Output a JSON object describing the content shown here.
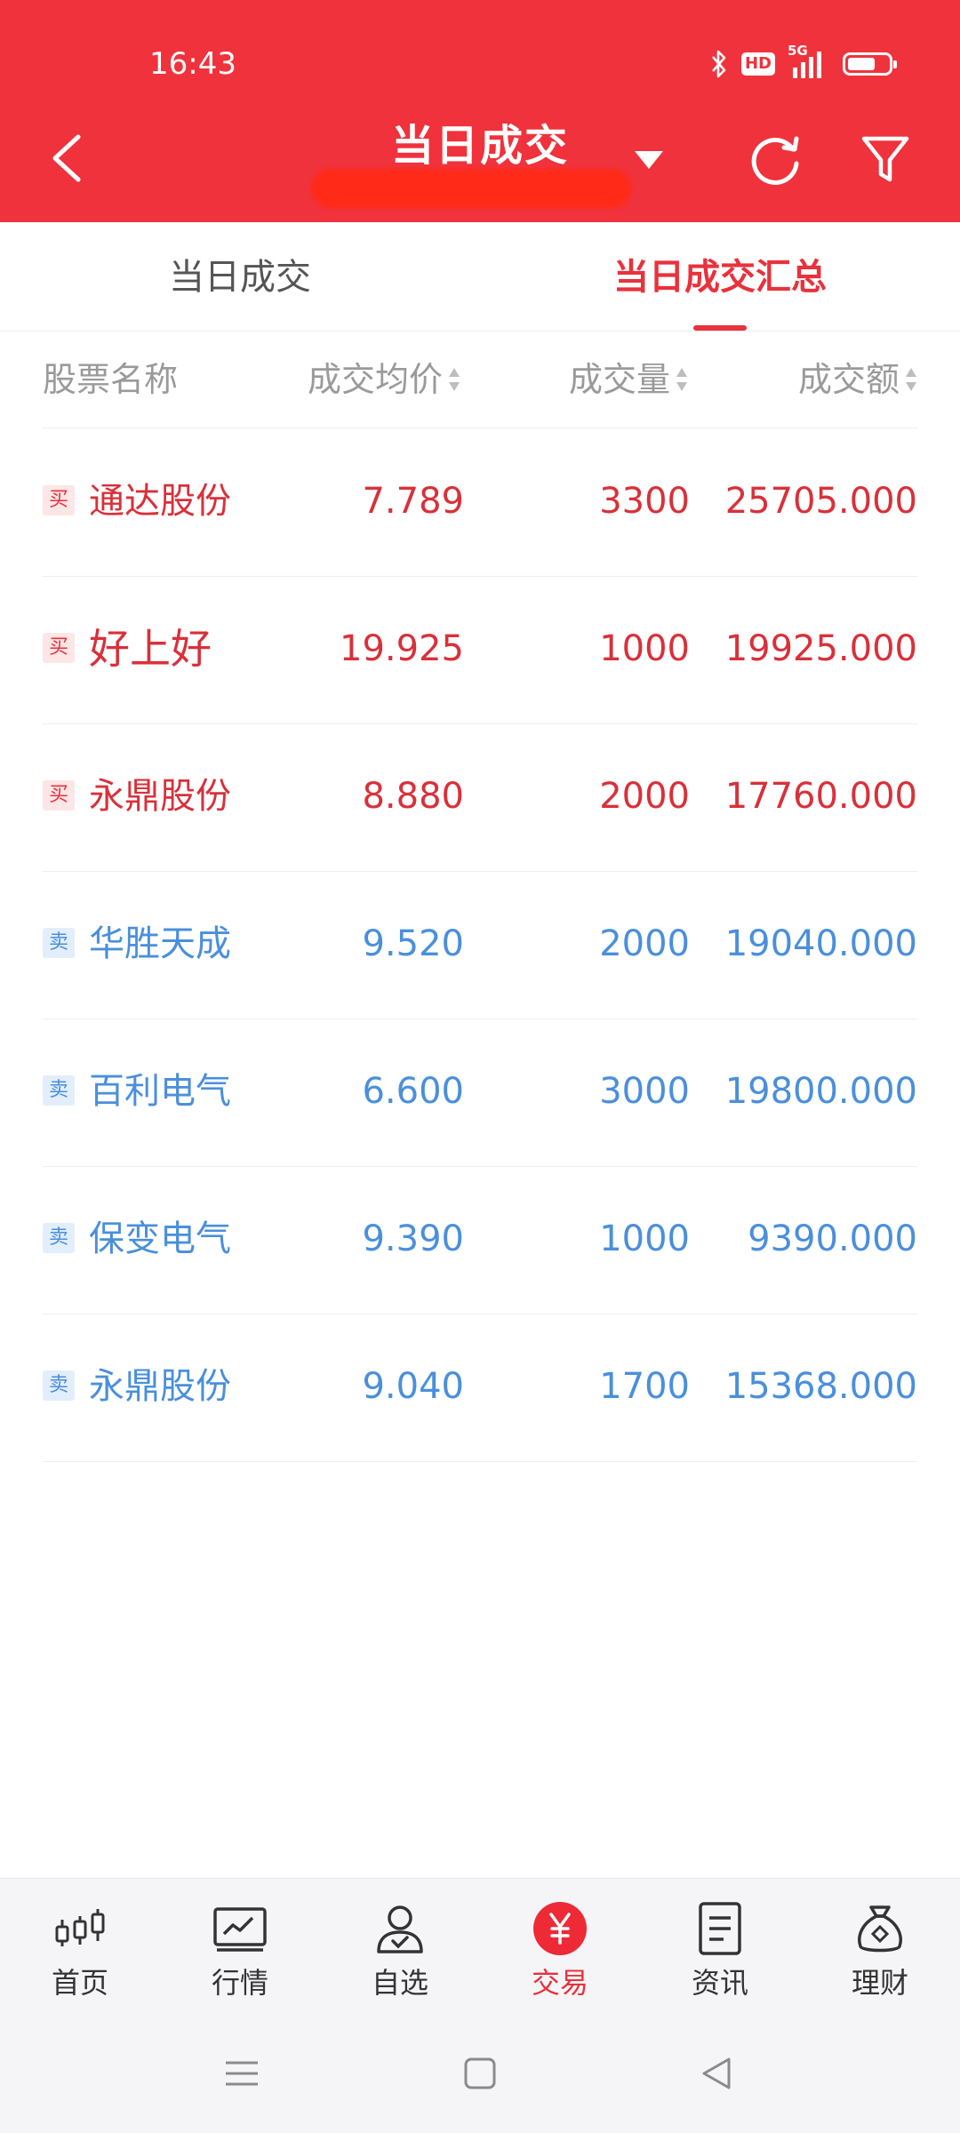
{
  "status_bar": {
    "time": "16:43",
    "hd": "HD",
    "network": "5G",
    "icons": [
      "bluetooth-icon",
      "hd-icon",
      "signal-icon",
      "battery-icon"
    ]
  },
  "header": {
    "title": "当日成交",
    "buttons": [
      "back-icon",
      "dropdown-icon",
      "refresh-icon",
      "filter-icon"
    ],
    "background_color": "#f0323c"
  },
  "tabs": [
    {
      "label": "当日成交",
      "active": false
    },
    {
      "label": "当日成交汇总",
      "active": true
    }
  ],
  "table": {
    "headers": [
      "股票名称",
      "成交均价",
      "成交量",
      "成交额"
    ],
    "rows": [
      {
        "side": "买",
        "name": "通达股份",
        "price": "7.789",
        "volume": "3300",
        "amount": "25705.000"
      },
      {
        "side": "买",
        "name": "好上好",
        "price": "19.925",
        "volume": "1000",
        "amount": "19925.000"
      },
      {
        "side": "买",
        "name": "永鼎股份",
        "price": "8.880",
        "volume": "2000",
        "amount": "17760.000"
      },
      {
        "side": "卖",
        "name": "华胜天成",
        "price": "9.520",
        "volume": "2000",
        "amount": "19040.000"
      },
      {
        "side": "卖",
        "name": "百利电气",
        "price": "6.600",
        "volume": "3000",
        "amount": "19800.000"
      },
      {
        "side": "卖",
        "name": "保变电气",
        "price": "9.390",
        "volume": "1000",
        "amount": "9390.000"
      },
      {
        "side": "卖",
        "name": "永鼎股份",
        "price": "9.040",
        "volume": "1700",
        "amount": "15368.000"
      }
    ],
    "buy_color": "#d9303a",
    "sell_color": "#4a8fdc"
  },
  "bottom_nav": [
    {
      "label": "首页",
      "icon": "candlestick-icon"
    },
    {
      "label": "行情",
      "icon": "chart-icon"
    },
    {
      "label": "自选",
      "icon": "user-check-icon"
    },
    {
      "label": "交易",
      "icon": "yuan-icon",
      "active": true
    },
    {
      "label": "资讯",
      "icon": "document-icon"
    },
    {
      "label": "理财",
      "icon": "money-bag-icon"
    }
  ],
  "system_nav": [
    "menu-icon",
    "home-icon",
    "back-triangle-icon"
  ]
}
